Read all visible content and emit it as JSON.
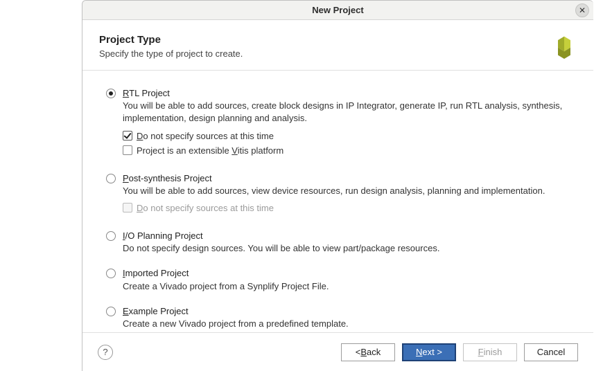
{
  "window": {
    "title": "New Project"
  },
  "header": {
    "title": "Project Type",
    "subtitle": "Specify the type of project to create."
  },
  "options": {
    "rtl": {
      "title_pre": "R",
      "title_rest": "TL Project",
      "desc": "You will be able to add sources, create block designs in IP Integrator, generate IP, run RTL analysis, synthesis, implementation, design planning and analysis.",
      "check1_pre": "D",
      "check1_rest": "o not specify sources at this time",
      "check2_pre": "Project is an extensible ",
      "check2_u": "V",
      "check2_rest": "itis platform"
    },
    "postsynth": {
      "title_pre": "P",
      "title_rest": "ost-synthesis Project",
      "desc": "You will be able to add sources, view device resources, run design analysis, planning and implementation.",
      "check1_pre": "D",
      "check1_rest": "o not specify sources at this time"
    },
    "io": {
      "title_pre": "I",
      "title_rest": "/O Planning Project",
      "desc": "Do not specify design sources. You will be able to view part/package resources."
    },
    "imported": {
      "title_pre": "I",
      "title_rest": "mported Project",
      "desc": "Create a Vivado project from a Synplify Project File."
    },
    "example": {
      "title_pre": "E",
      "title_rest": "xample Project",
      "desc": "Create a new Vivado project from a predefined template."
    }
  },
  "footer": {
    "back_pre": "< ",
    "back_u": "B",
    "back_rest": "ack",
    "next_u": "N",
    "next_rest": "ext >",
    "finish_u": "F",
    "finish_rest": "inish",
    "cancel": "Cancel"
  }
}
